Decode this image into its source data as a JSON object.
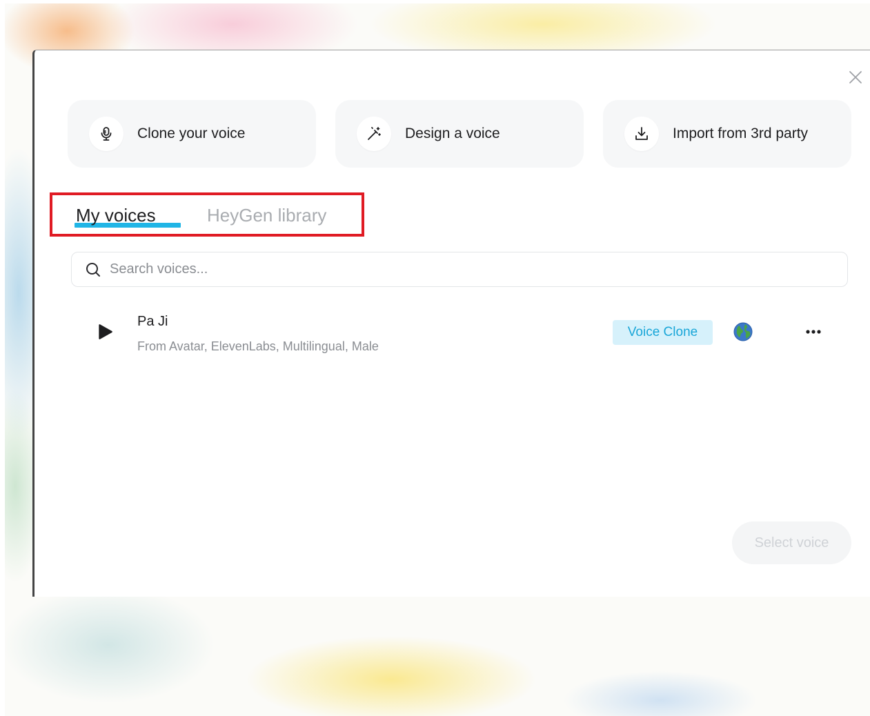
{
  "actions": [
    {
      "label": "Clone your voice",
      "icon": "microphone-icon"
    },
    {
      "label": "Design a voice",
      "icon": "magic-wand-icon"
    },
    {
      "label": "Import from 3rd party",
      "icon": "download-icon"
    }
  ],
  "tabs": {
    "active": "My voices",
    "inactive": "HeyGen library"
  },
  "search": {
    "placeholder": "Search voices..."
  },
  "voices": [
    {
      "name": "Pa Ji",
      "description": "From Avatar, ElevenLabs, Multilingual, Male",
      "badge": "Voice Clone"
    }
  ],
  "footer": {
    "select_label": "Select voice"
  },
  "colors": {
    "accent": "#20b5e6",
    "badge_bg": "#d6f1fb",
    "badge_text": "#19a6d8",
    "highlight": "#e01b24"
  }
}
